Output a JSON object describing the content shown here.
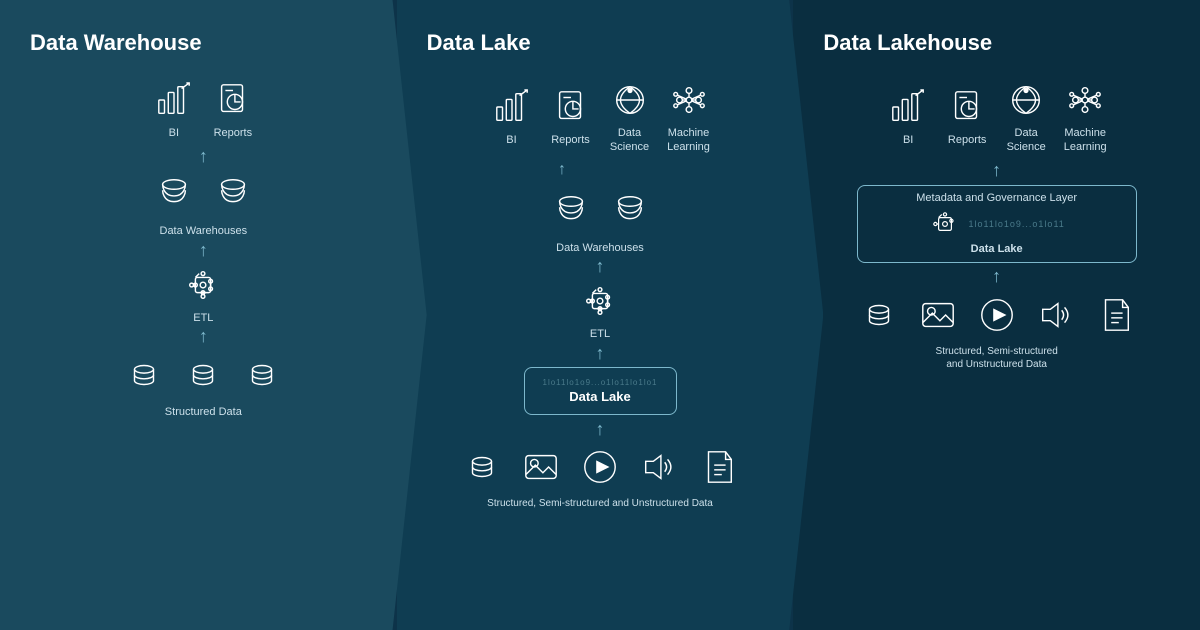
{
  "panels": [
    {
      "id": "warehouse",
      "title": "Data Warehouse",
      "topIcons": [
        {
          "label": "BI",
          "type": "bi"
        },
        {
          "label": "Reports",
          "type": "reports"
        }
      ],
      "layers": [
        {
          "label": "Data Warehouses",
          "type": "databases"
        },
        {
          "label": "ETL",
          "type": "etl"
        },
        {
          "label": "Structured Data",
          "type": "structured"
        }
      ]
    },
    {
      "id": "lake",
      "title": "Data Lake",
      "topIcons": [
        {
          "label": "BI",
          "type": "bi"
        },
        {
          "label": "Reports",
          "type": "reports"
        },
        {
          "label": "Data\nScience",
          "type": "datascience"
        },
        {
          "label": "Machine\nLearning",
          "type": "ml"
        }
      ],
      "layers": [
        {
          "label": "Data Warehouses",
          "type": "databases"
        },
        {
          "label": "ETL",
          "type": "etl"
        },
        {
          "label": "Data Lake",
          "type": "datalake"
        },
        {
          "label": "Structured, Semi-structured and Unstructured Data",
          "type": "unstructured"
        }
      ]
    },
    {
      "id": "lakehouse",
      "title": "Data Lakehouse",
      "topIcons": [
        {
          "label": "BI",
          "type": "bi"
        },
        {
          "label": "Reports",
          "type": "reports"
        },
        {
          "label": "Data\nScience",
          "type": "datascience"
        },
        {
          "label": "Machine\nLearning",
          "type": "ml"
        }
      ],
      "layers": [
        {
          "label": "Metadata and\nGovernance Layer",
          "type": "metadata"
        },
        {
          "label": "Data Lake",
          "type": "datalake2"
        },
        {
          "label": "Structured, Semi-structured\nand Unstructured Data",
          "type": "unstructured"
        }
      ]
    }
  ],
  "binaryString": "1lo11lo1o9...o1lo11lo1lo1lo1o1"
}
